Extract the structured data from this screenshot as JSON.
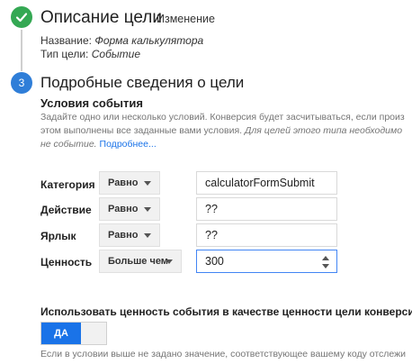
{
  "step1": {
    "title": "Описание цели",
    "edit_link": "Изменение",
    "name_label": "Название:",
    "name_value": "Форма калькулятора",
    "type_label": "Тип цели:",
    "type_value": "Событие"
  },
  "step3": {
    "number": "3",
    "title": "Подробные сведения о цели",
    "conditions_title": "Условия события",
    "description_main": "Задайте одно или несколько условий. Конверсия будет засчитываться, если произ этом выполнены все заданные вами условия.",
    "description_italic": "Для целей этого типа необходимо не событие.",
    "description_more": "Подробнее...",
    "rows": [
      {
        "label": "Категория",
        "operator": "Равно",
        "value": "calculatorFormSubmit"
      },
      {
        "label": "Действие",
        "operator": "Равно",
        "value": "??"
      },
      {
        "label": "Ярлык",
        "operator": "Равно",
        "value": "??"
      },
      {
        "label": "Ценность",
        "operator": "Больше чем",
        "value": "300"
      }
    ],
    "use_value_label": "Использовать ценность события в качестве ценности цели конверсии",
    "toggle_on": "ДА",
    "bottom_text": "Если в условии выше не задано значение, соответствующее вашему коду отслежи"
  }
}
